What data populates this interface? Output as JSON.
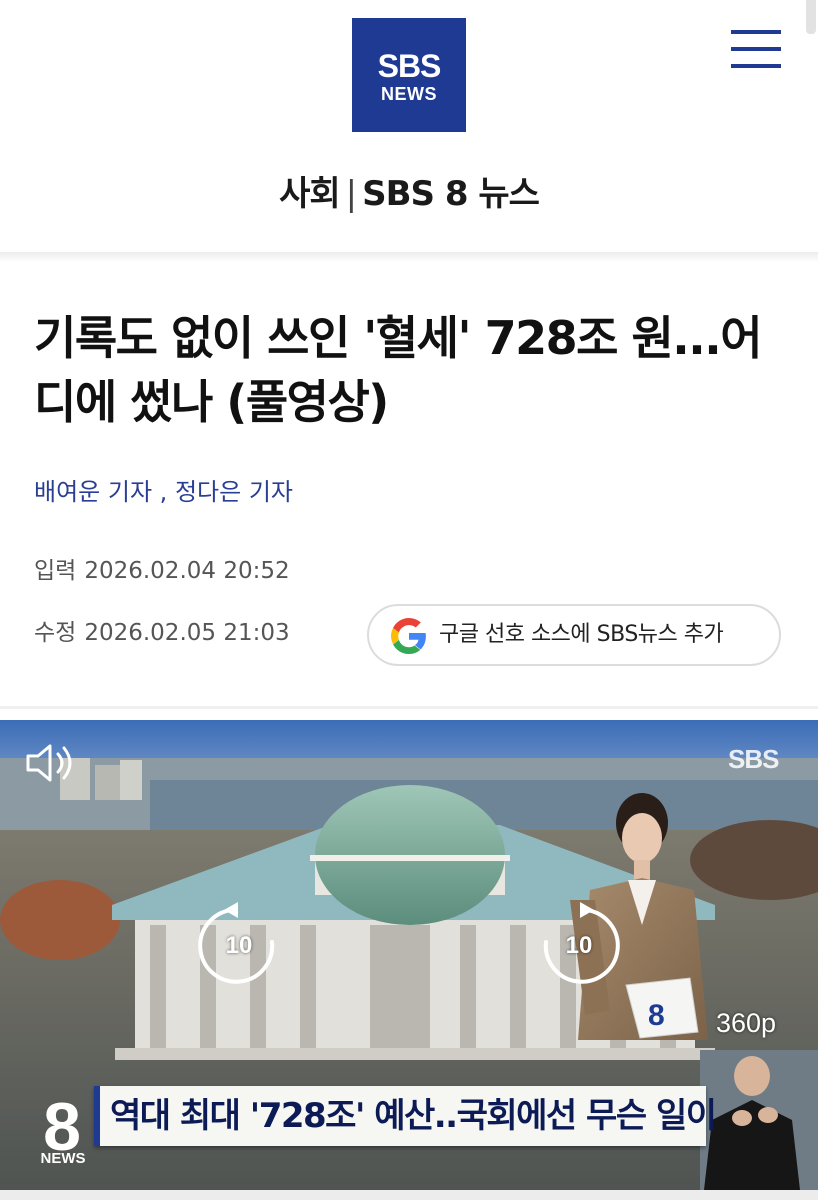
{
  "header": {
    "logo": {
      "line1": "SBS",
      "line2": "NEWS"
    },
    "menu_icon": "hamburger-menu-icon",
    "section": "사회",
    "separator": "|",
    "program": "SBS 8 뉴스"
  },
  "article": {
    "headline": "기록도 없이 쓰인 '혈세' 728조 원...어디에 썼나 (풀영상)",
    "reporters": [
      {
        "name": "배여운 기자"
      },
      {
        "name": "정다은 기자"
      }
    ],
    "reporter_separator": ",",
    "input_label": "입력",
    "input_datetime": "2026.02.04 20:52",
    "modified_label": "수정",
    "modified_datetime": "2026.02.05 21:03",
    "google_button": {
      "icon": "google-g-icon",
      "label": "구글 선호 소스에 SBS뉴스 추가"
    }
  },
  "video": {
    "sound_icon": "speaker-muted-icon",
    "rewind_seconds": "10",
    "forward_seconds": "10",
    "quality": "360p",
    "watermark": "SBS",
    "caption": "역대 최대 '728조' 예산..국회에선 무슨 일이",
    "program_logo_number": "8",
    "program_logo_text": "NEWS",
    "colors": {
      "caption_text": "#0c1b55",
      "caption_bg": "#f6f6f2",
      "accent": "#1e3a93"
    }
  },
  "colors": {
    "brand": "#1e3a93",
    "reporter_link": "#2a3e93",
    "meta_text": "#555555"
  }
}
